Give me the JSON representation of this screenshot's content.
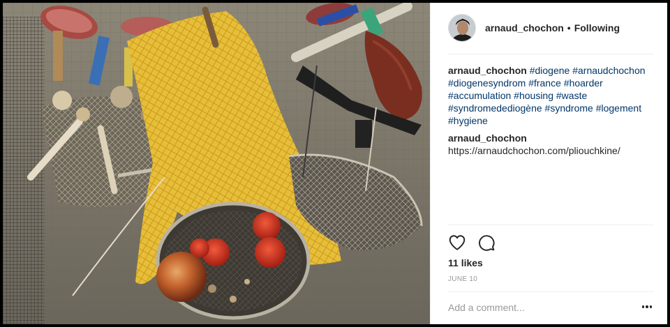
{
  "post": {
    "author": {
      "username": "arnaud_chochon",
      "separator": "•",
      "follow_state": "Following"
    },
    "caption": {
      "username": "arnaud_chochon",
      "hashtags": [
        "#diogene",
        "#arnaudchochon",
        "#diogenesyndrom",
        "#france",
        "#hoarder",
        "#accumulation",
        "#housing",
        "#waste",
        "#syndromedediogène",
        "#syndrome",
        "#logement",
        "#hygiene"
      ]
    },
    "comment": {
      "username": "arnaud_chochon",
      "text": "https://arnaudchochon.com/pliouchkine/"
    },
    "likes_text": "11 likes",
    "date_text": "JUNE 10",
    "comment_placeholder": "Add a comment..."
  },
  "icons": {
    "like": "heart-icon",
    "comment": "speech-bubble-icon",
    "more": "more-options-icon"
  },
  "colors": {
    "text": "#262626",
    "hashtag": "#003569",
    "muted": "#999999",
    "divider": "#efefef"
  }
}
